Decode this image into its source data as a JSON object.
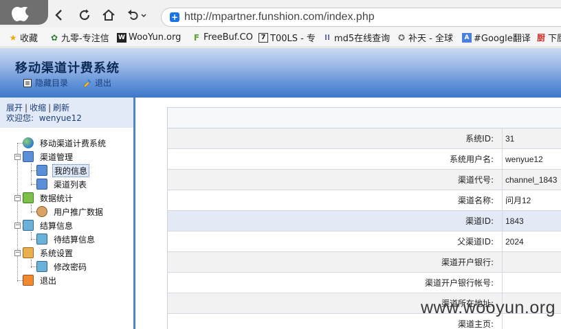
{
  "browser": {
    "url": "http://mpartner.funshion.com/index.php",
    "bookmarks": [
      {
        "label": "收藏",
        "icon": "star-icon"
      },
      {
        "label": "九零-专注信",
        "icon": "jiuling-icon"
      },
      {
        "label": "WooYun.org",
        "icon": "wooyun-icon"
      },
      {
        "label": "FreeBuf.CO",
        "icon": "freebuf-icon"
      },
      {
        "label": "T00LS - 专",
        "icon": "tools-icon"
      },
      {
        "label": "md5在线查询",
        "icon": "grid-icon"
      },
      {
        "label": "补天 - 全球",
        "icon": "butian-icon"
      },
      {
        "label": "#Google翻译",
        "icon": "translate-icon"
      },
      {
        "label": "下厨",
        "icon": "xiachufang-icon"
      }
    ]
  },
  "app": {
    "title": "移动渠道计费系统",
    "hide_menu": "隐藏目录",
    "logout": "退出"
  },
  "sidebar": {
    "expand": "展开",
    "collapse": "收缩",
    "refresh": "刷新",
    "welcome_label": "欢迎您:",
    "username": "wenyue12",
    "tree": {
      "root": "移动渠道计费系统",
      "channel_mgmt": "渠道管理",
      "my_info": "我的信息",
      "channel_list": "渠道列表",
      "data_stats": "数据统计",
      "user_promo": "用户推广数据",
      "settlement": "结算信息",
      "pending": "待结算信息",
      "settings": "系统设置",
      "change_pwd": "修改密码",
      "exit": "退出"
    }
  },
  "info_rows": [
    {
      "label": "系统ID:",
      "value": "31"
    },
    {
      "label": "系统用户名:",
      "value": "wenyue12"
    },
    {
      "label": "渠道代号:",
      "value": "channel_1843"
    },
    {
      "label": "渠道名称:",
      "value": "问月12"
    },
    {
      "label": "渠道ID:",
      "value": "1843"
    },
    {
      "label": "父渠道ID:",
      "value": "2024"
    },
    {
      "label": "渠道开户银行:",
      "value": ""
    },
    {
      "label": "渠道开户银行帐号:",
      "value": ""
    },
    {
      "label": "渠道所在地址:",
      "value": ""
    },
    {
      "label": "渠道主页:",
      "value": ""
    }
  ],
  "watermark": "www.wooyun.org"
}
